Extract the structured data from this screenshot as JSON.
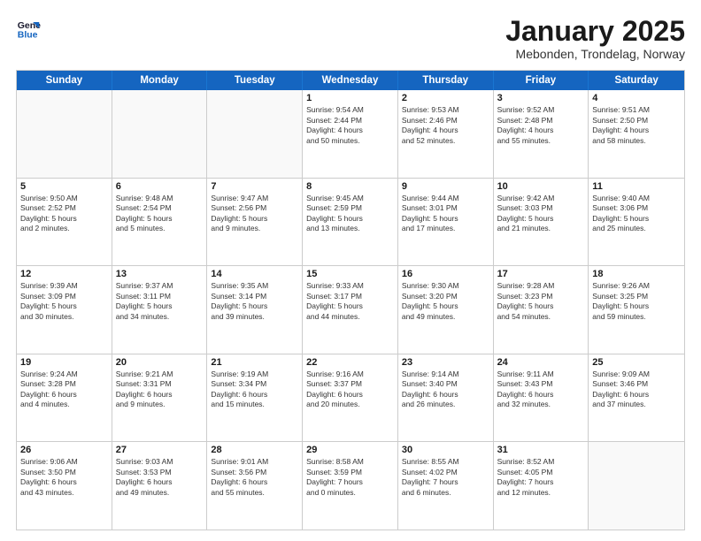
{
  "logo": {
    "line1": "General",
    "line2": "Blue"
  },
  "title": "January 2025",
  "subtitle": "Mebonden, Trondelag, Norway",
  "weekdays": [
    "Sunday",
    "Monday",
    "Tuesday",
    "Wednesday",
    "Thursday",
    "Friday",
    "Saturday"
  ],
  "rows": [
    [
      {
        "day": "",
        "text": ""
      },
      {
        "day": "",
        "text": ""
      },
      {
        "day": "",
        "text": ""
      },
      {
        "day": "1",
        "text": "Sunrise: 9:54 AM\nSunset: 2:44 PM\nDaylight: 4 hours\nand 50 minutes."
      },
      {
        "day": "2",
        "text": "Sunrise: 9:53 AM\nSunset: 2:46 PM\nDaylight: 4 hours\nand 52 minutes."
      },
      {
        "day": "3",
        "text": "Sunrise: 9:52 AM\nSunset: 2:48 PM\nDaylight: 4 hours\nand 55 minutes."
      },
      {
        "day": "4",
        "text": "Sunrise: 9:51 AM\nSunset: 2:50 PM\nDaylight: 4 hours\nand 58 minutes."
      }
    ],
    [
      {
        "day": "5",
        "text": "Sunrise: 9:50 AM\nSunset: 2:52 PM\nDaylight: 5 hours\nand 2 minutes."
      },
      {
        "day": "6",
        "text": "Sunrise: 9:48 AM\nSunset: 2:54 PM\nDaylight: 5 hours\nand 5 minutes."
      },
      {
        "day": "7",
        "text": "Sunrise: 9:47 AM\nSunset: 2:56 PM\nDaylight: 5 hours\nand 9 minutes."
      },
      {
        "day": "8",
        "text": "Sunrise: 9:45 AM\nSunset: 2:59 PM\nDaylight: 5 hours\nand 13 minutes."
      },
      {
        "day": "9",
        "text": "Sunrise: 9:44 AM\nSunset: 3:01 PM\nDaylight: 5 hours\nand 17 minutes."
      },
      {
        "day": "10",
        "text": "Sunrise: 9:42 AM\nSunset: 3:03 PM\nDaylight: 5 hours\nand 21 minutes."
      },
      {
        "day": "11",
        "text": "Sunrise: 9:40 AM\nSunset: 3:06 PM\nDaylight: 5 hours\nand 25 minutes."
      }
    ],
    [
      {
        "day": "12",
        "text": "Sunrise: 9:39 AM\nSunset: 3:09 PM\nDaylight: 5 hours\nand 30 minutes."
      },
      {
        "day": "13",
        "text": "Sunrise: 9:37 AM\nSunset: 3:11 PM\nDaylight: 5 hours\nand 34 minutes."
      },
      {
        "day": "14",
        "text": "Sunrise: 9:35 AM\nSunset: 3:14 PM\nDaylight: 5 hours\nand 39 minutes."
      },
      {
        "day": "15",
        "text": "Sunrise: 9:33 AM\nSunset: 3:17 PM\nDaylight: 5 hours\nand 44 minutes."
      },
      {
        "day": "16",
        "text": "Sunrise: 9:30 AM\nSunset: 3:20 PM\nDaylight: 5 hours\nand 49 minutes."
      },
      {
        "day": "17",
        "text": "Sunrise: 9:28 AM\nSunset: 3:23 PM\nDaylight: 5 hours\nand 54 minutes."
      },
      {
        "day": "18",
        "text": "Sunrise: 9:26 AM\nSunset: 3:25 PM\nDaylight: 5 hours\nand 59 minutes."
      }
    ],
    [
      {
        "day": "19",
        "text": "Sunrise: 9:24 AM\nSunset: 3:28 PM\nDaylight: 6 hours\nand 4 minutes."
      },
      {
        "day": "20",
        "text": "Sunrise: 9:21 AM\nSunset: 3:31 PM\nDaylight: 6 hours\nand 9 minutes."
      },
      {
        "day": "21",
        "text": "Sunrise: 9:19 AM\nSunset: 3:34 PM\nDaylight: 6 hours\nand 15 minutes."
      },
      {
        "day": "22",
        "text": "Sunrise: 9:16 AM\nSunset: 3:37 PM\nDaylight: 6 hours\nand 20 minutes."
      },
      {
        "day": "23",
        "text": "Sunrise: 9:14 AM\nSunset: 3:40 PM\nDaylight: 6 hours\nand 26 minutes."
      },
      {
        "day": "24",
        "text": "Sunrise: 9:11 AM\nSunset: 3:43 PM\nDaylight: 6 hours\nand 32 minutes."
      },
      {
        "day": "25",
        "text": "Sunrise: 9:09 AM\nSunset: 3:46 PM\nDaylight: 6 hours\nand 37 minutes."
      }
    ],
    [
      {
        "day": "26",
        "text": "Sunrise: 9:06 AM\nSunset: 3:50 PM\nDaylight: 6 hours\nand 43 minutes."
      },
      {
        "day": "27",
        "text": "Sunrise: 9:03 AM\nSunset: 3:53 PM\nDaylight: 6 hours\nand 49 minutes."
      },
      {
        "day": "28",
        "text": "Sunrise: 9:01 AM\nSunset: 3:56 PM\nDaylight: 6 hours\nand 55 minutes."
      },
      {
        "day": "29",
        "text": "Sunrise: 8:58 AM\nSunset: 3:59 PM\nDaylight: 7 hours\nand 0 minutes."
      },
      {
        "day": "30",
        "text": "Sunrise: 8:55 AM\nSunset: 4:02 PM\nDaylight: 7 hours\nand 6 minutes."
      },
      {
        "day": "31",
        "text": "Sunrise: 8:52 AM\nSunset: 4:05 PM\nDaylight: 7 hours\nand 12 minutes."
      },
      {
        "day": "",
        "text": ""
      }
    ]
  ]
}
